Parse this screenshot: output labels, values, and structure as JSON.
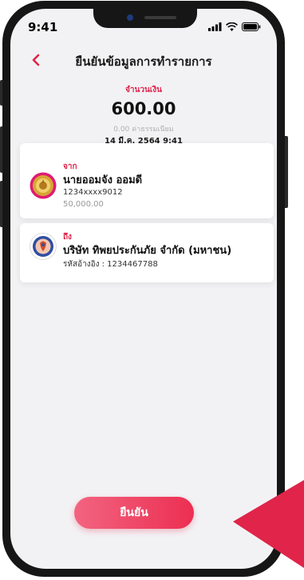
{
  "status_bar": {
    "time": "9:41"
  },
  "header": {
    "title": "ยืนยันข้อมูลการทำรายการ"
  },
  "transaction": {
    "amount_label": "จำนวนเงิน",
    "amount": "600.00",
    "fee": "0.00 ค่าธรรมเนียม",
    "datetime": "14 มี.ค. 2564  9:41"
  },
  "from": {
    "label": "จาก",
    "name": "นายออมจัง ออมดี",
    "account": "1234xxxx9012",
    "balance": "50,000.00"
  },
  "to": {
    "label": "ถึง",
    "name": "บริษัท ทิพยประกันภัย จำกัด (มหาชน)",
    "reference": "รหัสอ้างอิง : 1234467788"
  },
  "actions": {
    "confirm_label": "ยืนยัน"
  },
  "colors": {
    "accent": "#e0244a",
    "button_start": "#f26480",
    "button_end": "#ec2f52"
  }
}
